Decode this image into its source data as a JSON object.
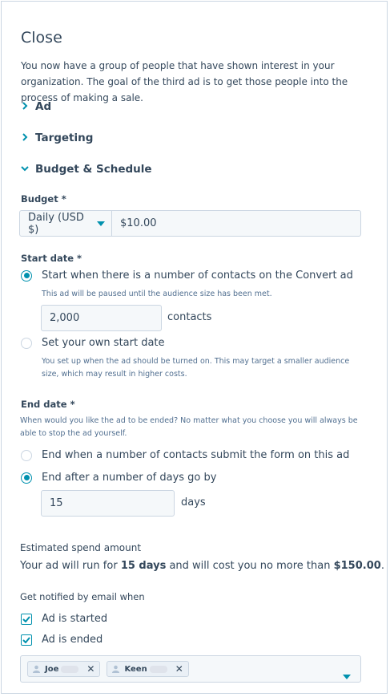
{
  "title": "Close",
  "intro": "You now have a group of people that have shown interest in your organization. The goal of the third ad is to get those people into the process of making a sale.",
  "sections": {
    "ad": "Ad",
    "targeting": "Targeting",
    "budget_schedule": "Budget & Schedule"
  },
  "budget": {
    "label": "Budget *",
    "type_select": "Daily (USD $)",
    "amount": "$10.00"
  },
  "start_date": {
    "label": "Start date *",
    "option1": "Start when there is a number of contacts on the Convert ad",
    "option1_help": "This ad will be paused until the audience size has been met.",
    "contacts_value": "2,000",
    "contacts_unit": "contacts",
    "option2": "Set your own start date",
    "option2_help": "You set up when the ad should be turned on. This may target a smaller audience size, which may result in higher costs.",
    "selected": "option1"
  },
  "end_date": {
    "label": "End date *",
    "help": "When would you like the ad to be ended? No matter what you choose you will always be able to stop the ad yourself.",
    "option1": "End when a number of contacts submit the form on this ad",
    "option2": "End after a number of days go by",
    "days_value": "15",
    "days_unit": "days",
    "selected": "option2"
  },
  "estimate": {
    "label": "Estimated spend amount",
    "prefix": "Your ad will run for ",
    "days": "15 days",
    "middle": " and will cost you no more than ",
    "amount": "$150.00",
    "suffix": "."
  },
  "notify": {
    "label": "Get notified by email when",
    "started": "Ad is started",
    "ended": "Ad is ended",
    "started_checked": true,
    "ended_checked": true,
    "recipients": [
      "Joe",
      "Keen"
    ]
  },
  "colors": {
    "accent": "#0091ae",
    "text": "#33475b",
    "border": "#cbd6e2",
    "field_bg": "#f5f8fa"
  }
}
